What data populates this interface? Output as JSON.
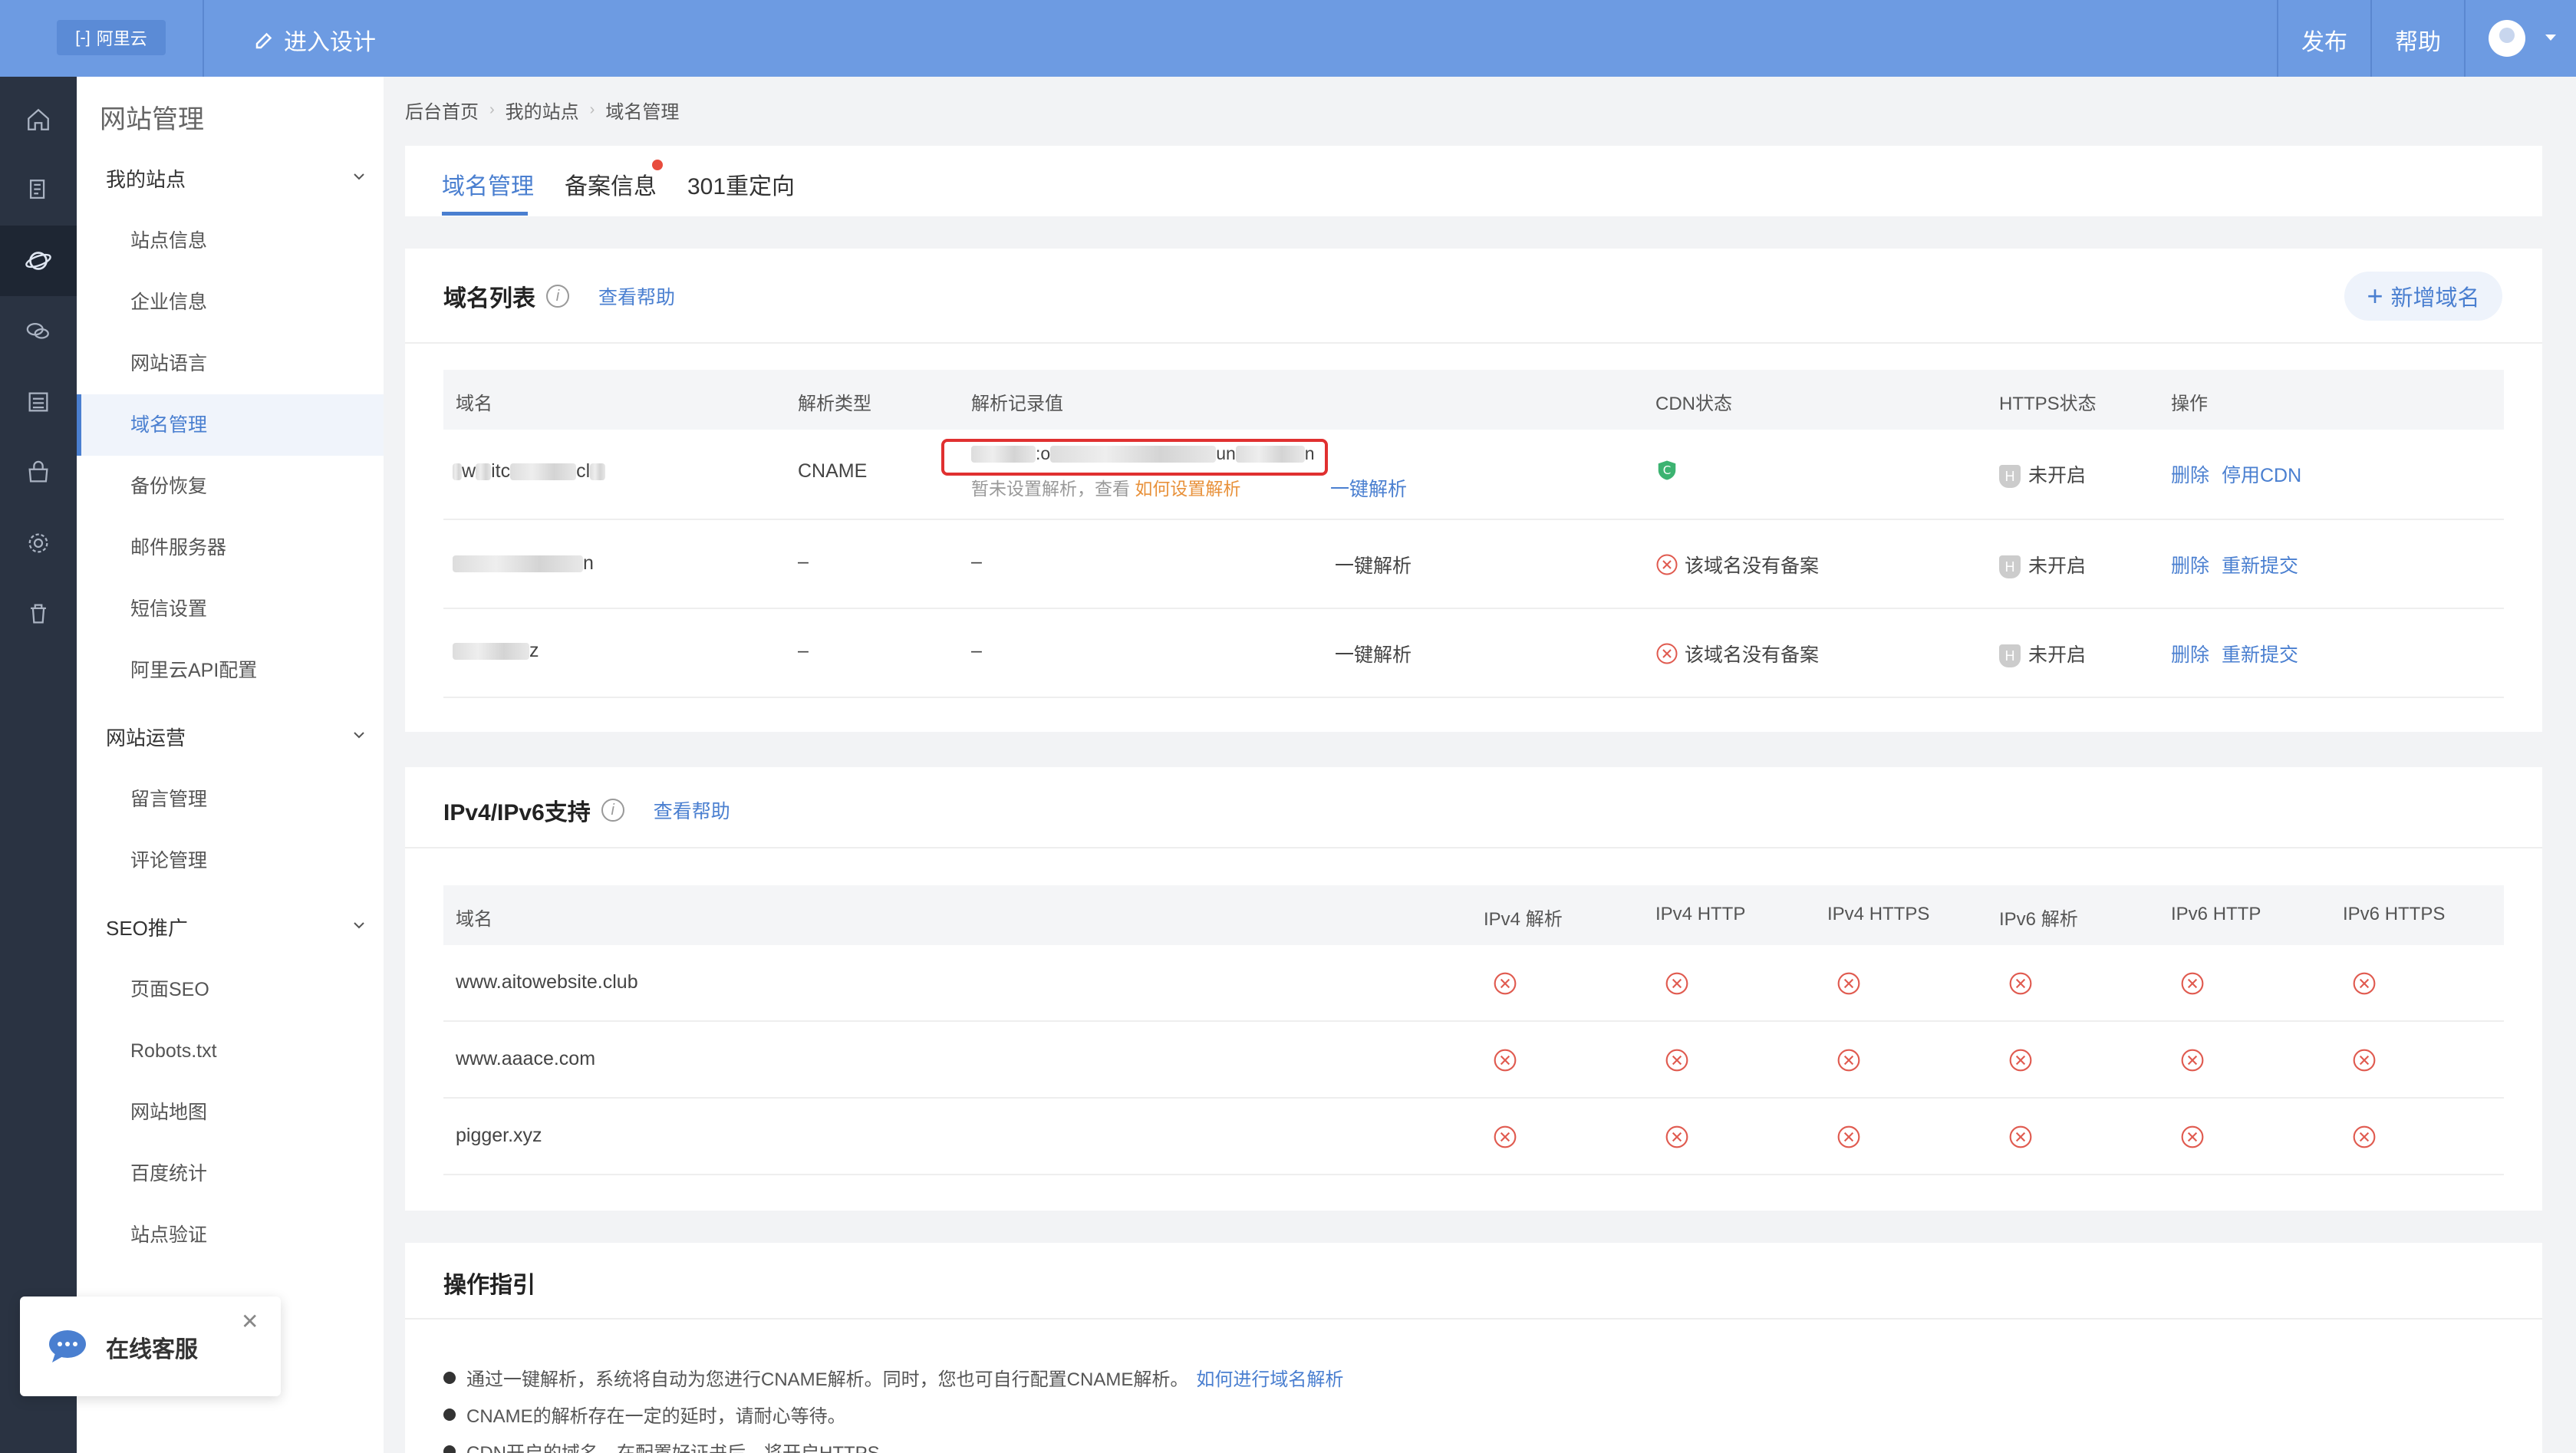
{
  "topbar": {
    "logo_text": "阿里云",
    "design_label": "进入设计",
    "publish_label": "发布",
    "help_label": "帮助"
  },
  "sidebar": {
    "title": "网站管理",
    "groups": [
      {
        "label": "我的站点",
        "items": [
          "站点信息",
          "企业信息",
          "网站语言",
          "域名管理",
          "备份恢复",
          "邮件服务器",
          "短信设置",
          "阿里云API配置"
        ]
      },
      {
        "label": "网站运营",
        "items": [
          "留言管理",
          "评论管理"
        ]
      },
      {
        "label": "SEO推广",
        "items": [
          "页面SEO",
          "Robots.txt",
          "网站地图",
          "百度统计",
          "站点验证"
        ]
      }
    ],
    "active_item": "域名管理"
  },
  "breadcrumb": [
    "后台首页",
    "我的站点",
    "域名管理"
  ],
  "tabs": [
    {
      "label": "域名管理",
      "active": true
    },
    {
      "label": "备案信息",
      "badge": true
    },
    {
      "label": "301重定向"
    }
  ],
  "domain_list": {
    "title": "域名列表",
    "help_link": "查看帮助",
    "add_button": "新增域名",
    "columns": [
      "域名",
      "解析类型",
      "解析记录值",
      "CDN状态",
      "HTTPS状态",
      "操作"
    ],
    "rows": [
      {
        "domain_partial": [
          "w",
          "itc",
          "cl"
        ],
        "type": "CNAME",
        "record_partial": [
          ":o",
          "un",
          "n"
        ],
        "record_hint": "暂未设置解析，查看 ",
        "record_hint_link": "如何设置解析",
        "resolve": "一键解析",
        "cdn": "C",
        "https": "未开启",
        "actions": [
          "删除",
          "停用CDN"
        ]
      },
      {
        "domain_partial": [
          "n"
        ],
        "type": "–",
        "record": "–",
        "resolve": "一键解析",
        "cdn": "该域名没有备案",
        "https": "未开启",
        "actions": [
          "删除",
          "重新提交"
        ]
      },
      {
        "domain_partial": [
          "z"
        ],
        "domain_suffix": "xyz",
        "type": "–",
        "record": "–",
        "resolve": "一键解析",
        "cdn": "该域名没有备案",
        "https": "未开启",
        "actions": [
          "删除",
          "重新提交"
        ]
      }
    ]
  },
  "ipv6": {
    "title": "IPv4/IPv6支持",
    "help_link": "查看帮助",
    "columns": [
      "域名",
      "IPv4 解析",
      "IPv4 HTTP",
      "IPv4 HTTPS",
      "IPv6 解析",
      "IPv6 HTTP",
      "IPv6 HTTPS"
    ],
    "rows": [
      "www.aitowebsite.club",
      "www.aaace.com",
      "pigger.xyz"
    ],
    "status": "unsupported"
  },
  "guide": {
    "title": "操作指引",
    "items": [
      {
        "text": "通过一键解析，系统将自动为您进行CNAME解析。同时，您也可自行配置CNAME解析。",
        "link": "如何进行域名解析"
      },
      {
        "text": "CNAME的解析存在一定的延时，请耐心等待。"
      },
      {
        "text": "CDN开启的域名，在配置好证书后，将开启HTTPS"
      }
    ]
  },
  "chat": {
    "label": "在线客服"
  },
  "colors": {
    "accent": "#4a7fd0",
    "topbar": "#6d9be2",
    "rail": "#2a3342",
    "error": "#e05a4f",
    "cdn_green": "#3cb371"
  }
}
